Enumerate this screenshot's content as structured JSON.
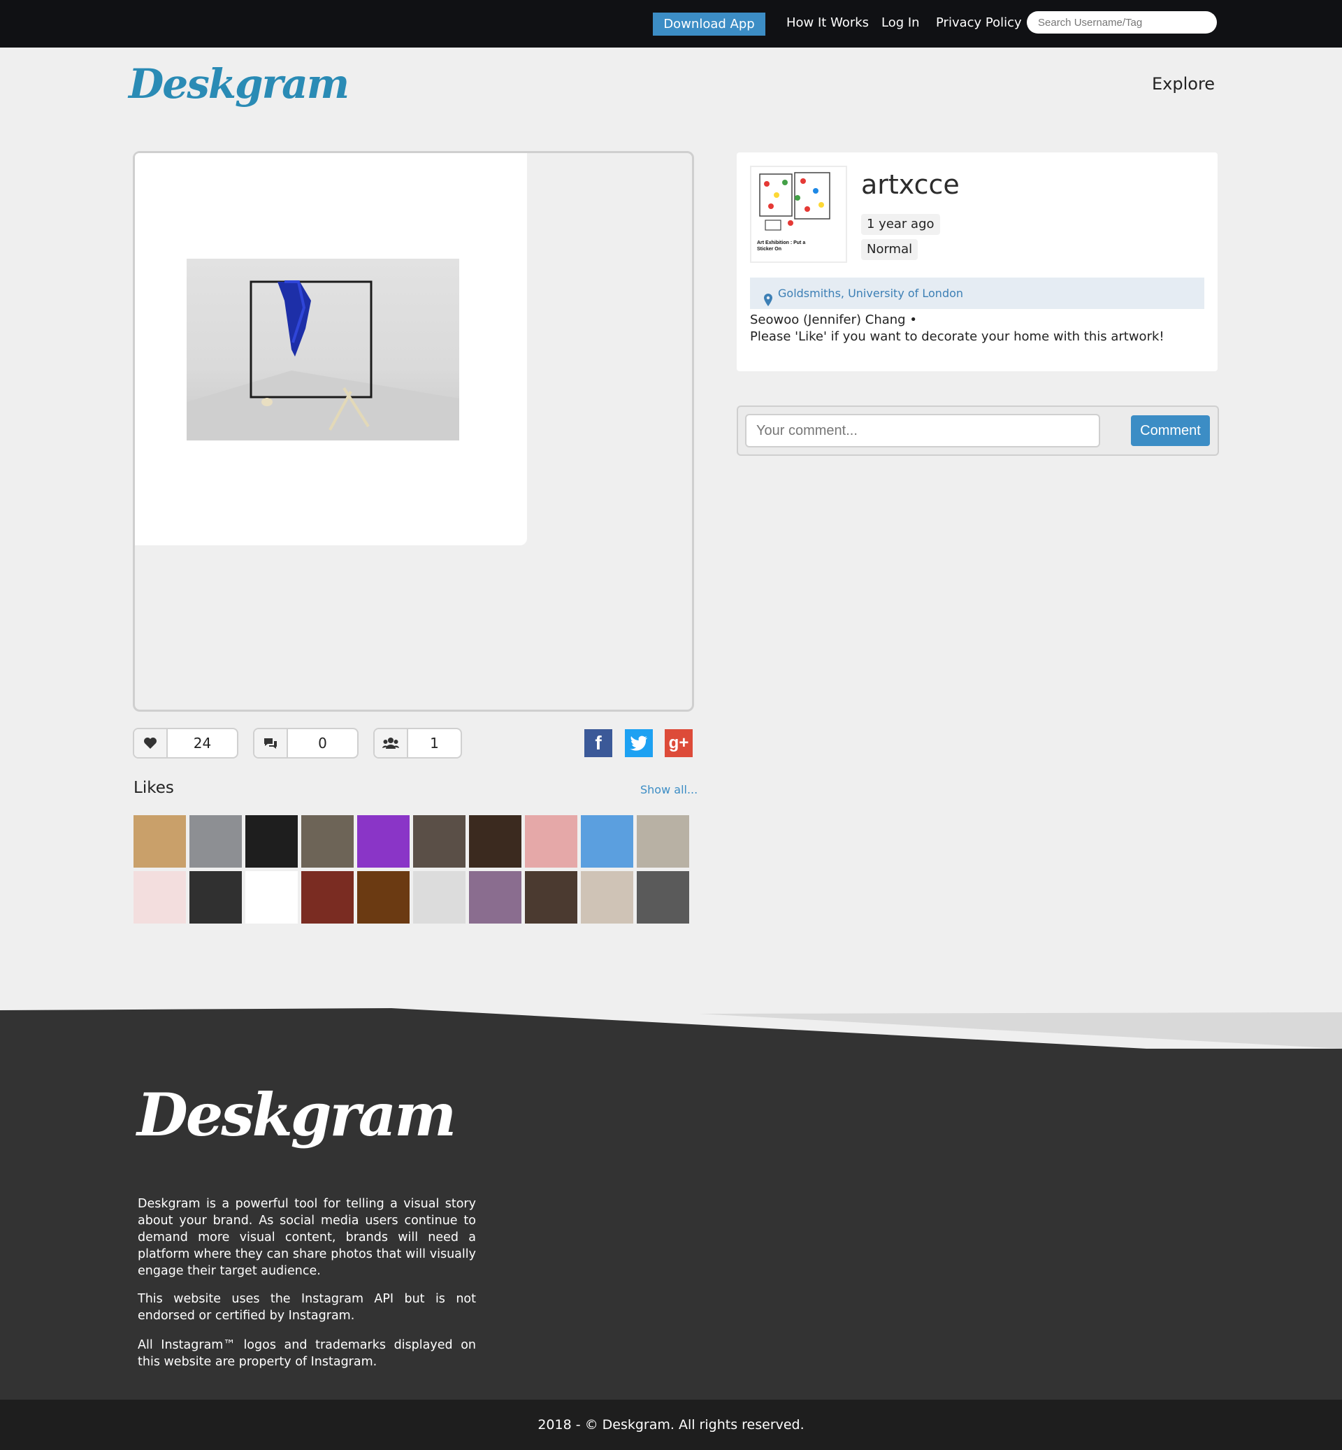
{
  "nav": {
    "download_label": "Download App",
    "how_label": "How It Works",
    "login_label": "Log In",
    "privacy_label": "Privacy Policy",
    "search_placeholder": "Search Username/Tag"
  },
  "header": {
    "logo": "Deskgram",
    "explore_label": "Explore"
  },
  "post": {
    "likes_count": "24",
    "comments_count": "0",
    "users_count": "1"
  },
  "likes": {
    "title": "Likes",
    "show_all": "Show all...",
    "thumb_colors": [
      "#c9a06a",
      "#8d8f93",
      "#1e1e1e",
      "#6d6457",
      "#8a35c7",
      "#5a4f47",
      "#3b2a1f",
      "#e5a8a8",
      "#5b9fdf",
      "#b8b1a4",
      "#f3dede",
      "#303030",
      "#ffffff",
      "#7a2c22",
      "#6b3a12",
      "#dcdcdc",
      "#8a6d8f",
      "#4b3a30",
      "#cfc3b6",
      "#5a5a5a"
    ]
  },
  "user": {
    "username": "artxcce",
    "time_ago": "1 year ago",
    "filter": "Normal",
    "avatar_text": "Art Exhibition : Put a Sticker On",
    "location": "Goldsmiths, University of London",
    "caption_line1": "Seowoo (Jennifer) Chang •",
    "caption_line2": "Please 'Like' if you want to decorate your home with this artwork!"
  },
  "comment": {
    "placeholder": "Your comment...",
    "button_label": "Comment"
  },
  "footer": {
    "logo": "Deskgram",
    "para1": "Deskgram is a powerful tool for telling a visual story about your brand. As social media users continue to demand more visual content, brands will need a platform where they can share photos that will visually engage their target audience.",
    "para2": "This website uses the Instagram API but is not endorsed or certified by Instagram.",
    "para3": "All Instagram™ logos and trademarks displayed on this website are property of Instagram.",
    "copyright": "2018 - © Deskgram. All rights reserved."
  },
  "colors": {
    "accent": "#3c8dc5",
    "nav_bg": "#101114",
    "footer_bg": "#333333",
    "facebook": "#3b5998",
    "twitter": "#1da1f2",
    "google_plus": "#dd4b39"
  }
}
